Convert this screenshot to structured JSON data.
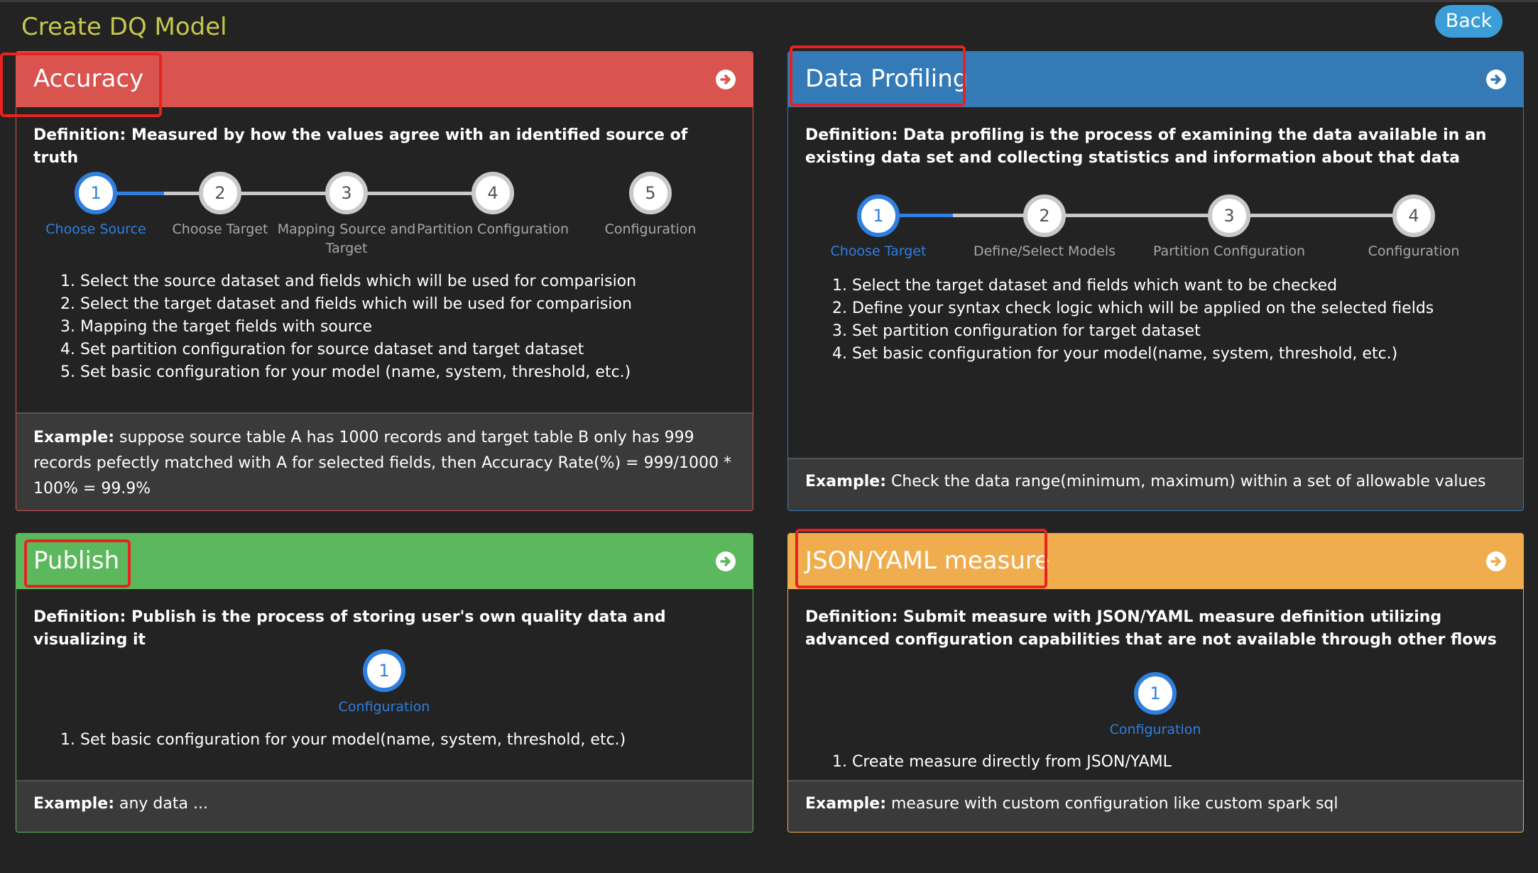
{
  "page": {
    "title": "Create DQ Model",
    "back_label": "Back"
  },
  "cards": {
    "accuracy": {
      "title": "Accuracy",
      "color": "#d9534f",
      "definition": "Definition: Measured by how the values agree with an identified source of truth",
      "steps": [
        {
          "num": "1",
          "label": "Choose Source"
        },
        {
          "num": "2",
          "label": "Choose Target"
        },
        {
          "num": "3",
          "label": "Mapping Source and Target"
        },
        {
          "num": "4",
          "label": "Partition Configuration"
        },
        {
          "num": "5",
          "label": "Configuration"
        }
      ],
      "list": [
        "1. Select the source dataset and fields which will be used for comparision",
        "2. Select the target dataset and fields which will be used for comparision",
        "3. Mapping the target fields with source",
        "4. Set partition configuration for source dataset and target dataset",
        "5. Set basic configuration for your model (name, system, threshold, etc.)"
      ],
      "example_label": "Example:",
      "example_text": " suppose source table A has 1000 records and target table B only has 999 records pefectly matched with A for selected fields, then Accuracy Rate(%) = 999/1000 * 100% = 99.9%"
    },
    "profiling": {
      "title": "Data Profiling",
      "color": "#337ab7",
      "definition": "Definition: Data profiling is the process of examining the data available in an existing data set and collecting statistics and information about that data",
      "steps": [
        {
          "num": "1",
          "label": "Choose Target"
        },
        {
          "num": "2",
          "label": "Define/Select Models"
        },
        {
          "num": "3",
          "label": "Partition Configuration"
        },
        {
          "num": "4",
          "label": "Configuration"
        }
      ],
      "list": [
        "1. Select the target dataset and fields which want to be checked",
        "2. Define your syntax check logic which will be applied on the selected fields",
        "3. Set partition configuration for target dataset",
        "4. Set basic configuration for your model(name, system, threshold, etc.)"
      ],
      "example_label": "Example:",
      "example_text": " Check the data range(minimum, maximum) within a set of allowable values"
    },
    "publish": {
      "title": "Publish",
      "color": "#5cb85c",
      "definition": "Definition: Publish is the process of storing user's own quality data and visualizing it",
      "steps": [
        {
          "num": "1",
          "label": "Configuration"
        }
      ],
      "list": [
        "1. Set basic configuration for your model(name, system, threshold, etc.)"
      ],
      "example_label": "Example:",
      "example_text": " any data ..."
    },
    "json": {
      "title": "JSON/YAML measure",
      "color": "#f0ad4e",
      "definition": "Definition: Submit measure with JSON/YAML measure definition utilizing advanced configuration capabilities that are not available through other flows",
      "steps": [
        {
          "num": "1",
          "label": "Configuration"
        }
      ],
      "list": [
        "1. Create measure directly from JSON/YAML"
      ],
      "example_label": "Example:",
      "example_text": " measure with custom configuration like custom spark sql"
    }
  },
  "colors": {
    "accent": "#2f7fe0",
    "title_text": "#c5c84c",
    "callout": "#e8231f"
  },
  "icons": {
    "card_link": "arrow-circle-right-icon"
  }
}
